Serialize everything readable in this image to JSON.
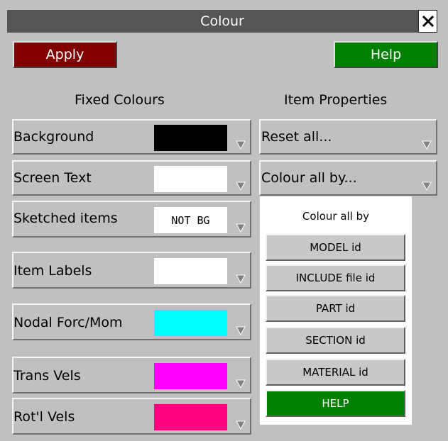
{
  "window": {
    "title": "Colour",
    "close_glyph": "✕"
  },
  "toolbar": {
    "apply_label": "Apply",
    "help_label": "Help"
  },
  "headings": {
    "fixed": "Fixed Colours",
    "item": "Item Properties"
  },
  "fixed_colours": [
    {
      "label": "Background",
      "color": "#000000",
      "text": ""
    },
    {
      "label": "Screen Text",
      "color": "#ffffff",
      "text": ""
    },
    {
      "label": "Sketched items",
      "color": "#ffffff",
      "text": "NOT BG"
    },
    {
      "label": "Item Labels",
      "color": "#ffffff",
      "text": ""
    },
    {
      "label": "Nodal Forc/Mom",
      "color": "#00ffff",
      "text": ""
    },
    {
      "label": "Trans Vels",
      "color": "#ff00ff",
      "text": ""
    },
    {
      "label": "Rot'l Vels",
      "color": "#ff0080",
      "text": ""
    }
  ],
  "item_properties": {
    "reset_label": "Reset all...",
    "colour_all_label": "Colour all by..."
  },
  "menu": {
    "title": "Colour all by",
    "items": [
      "MODEL id",
      "INCLUDE file id",
      "PART id",
      "SECTION id",
      "MATERIAL id"
    ],
    "help_label": "HELP"
  },
  "colors": {
    "apply": "#800000",
    "help": "#008000",
    "background": "#c0c0c0",
    "titlebar": "#555555"
  }
}
